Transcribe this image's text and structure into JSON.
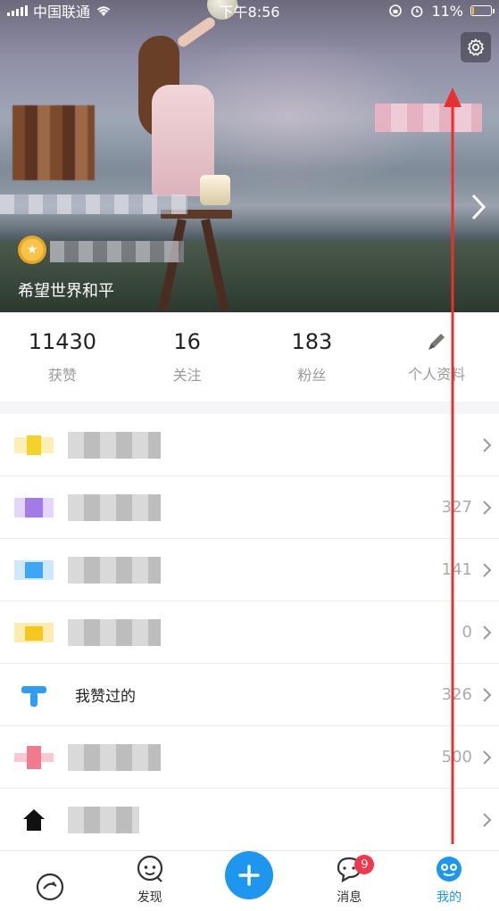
{
  "status_bar": {
    "carrier": "中国联通",
    "time": "下午8:56",
    "battery": "11%",
    "battery_level": 0.11
  },
  "profile": {
    "motto": "希望世界和平"
  },
  "stats": [
    {
      "value": "11430",
      "label": "获赞"
    },
    {
      "value": "16",
      "label": "关注"
    },
    {
      "value": "183",
      "label": "粉丝"
    },
    {
      "value": "",
      "label": "个人资料"
    }
  ],
  "menu": [
    {
      "label": "",
      "count": "",
      "icon": "yellow-icon",
      "color": "#f7d02a"
    },
    {
      "label": "",
      "count": "327",
      "icon": "purple-icon",
      "color": "#a37be8"
    },
    {
      "label": "",
      "count": "141",
      "icon": "blue-icon",
      "color": "#3ea7f5"
    },
    {
      "label": "",
      "count": "0",
      "icon": "yellow-folder-icon",
      "color": "#f7c71f"
    },
    {
      "label": "我赞过的",
      "count": "326",
      "icon": "thumb-icon",
      "color": "#2f9df4"
    },
    {
      "label": "",
      "count": "500",
      "icon": "pink-icon",
      "color": "#ef7b8c"
    },
    {
      "label": "",
      "count": "",
      "icon": "house-icon",
      "color": "#111111"
    }
  ],
  "tabbar": {
    "tabs": [
      {
        "label": "",
        "icon": "home-bird-icon"
      },
      {
        "label": "发现",
        "icon": "discover-icon"
      },
      {
        "label": "",
        "icon": "plus-icon"
      },
      {
        "label": "消息",
        "icon": "message-icon",
        "badge": "9"
      },
      {
        "label": "我的",
        "icon": "me-icon"
      }
    ],
    "accent": "#1c96ef",
    "badge_color": "#f3374b"
  }
}
